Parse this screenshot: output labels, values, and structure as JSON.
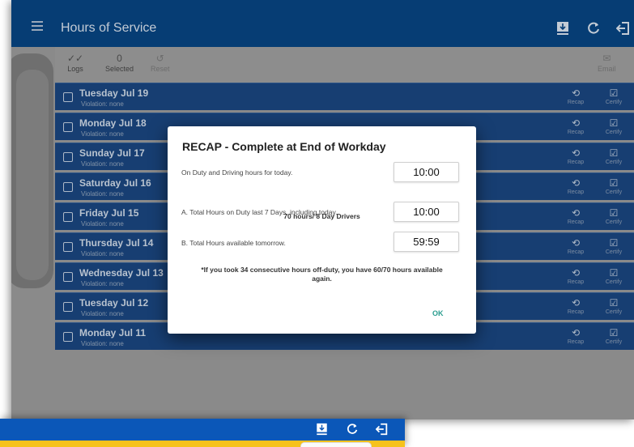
{
  "app": {
    "title": "Hours of Service"
  },
  "topbar_icons": {
    "upload": "upload-icon",
    "refresh": "refresh-icon",
    "logout": "logout-icon",
    "menu": "menu-icon"
  },
  "toolbar": {
    "logs_label": "Logs",
    "selected_count": "0",
    "selected_label": "Selected",
    "reset_label": "Reset",
    "email_label": "Email"
  },
  "logs": [
    {
      "day": "Tuesday Jul 19",
      "violation": "Violation: none"
    },
    {
      "day": "Monday Jul 18",
      "violation": "Violation: none"
    },
    {
      "day": "Sunday Jul 17",
      "violation": "Violation: none"
    },
    {
      "day": "Saturday Jul 16",
      "violation": "Violation: none"
    },
    {
      "day": "Friday Jul 15",
      "violation": "Violation: none"
    },
    {
      "day": "Thursday Jul 14",
      "violation": "Violation: none"
    },
    {
      "day": "Wednesday Jul 13",
      "violation": "Violation: none"
    },
    {
      "day": "Tuesday Jul 12",
      "violation": "Violation: none"
    },
    {
      "day": "Monday Jul 11",
      "violation": "Violation: none"
    }
  ],
  "row_actions": {
    "recap": "Recap",
    "certify": "Certify"
  },
  "dialog": {
    "title": "RECAP - Complete at End of Workday",
    "on_duty_label": "On Duty and Driving hours for today.",
    "on_duty_value": "10:00",
    "rule_label": "70 hours/ 8 Day Drivers",
    "total_label": "A. Total Hours on Duty last 7 Days, including today.",
    "total_value": "10:00",
    "available_label": "B. Total Hours available tomorrow.",
    "available_value": "59:59",
    "note": "*If you took 34 consecutive hours off-duty, you have 60/70 hours available again.",
    "ok": "OK"
  },
  "colors": {
    "topbar": "#063d74",
    "row": "#173e72",
    "ok": "#2a9d8f",
    "inset_bar": "#0b57b8",
    "inset_strip": "#f6c21c"
  }
}
